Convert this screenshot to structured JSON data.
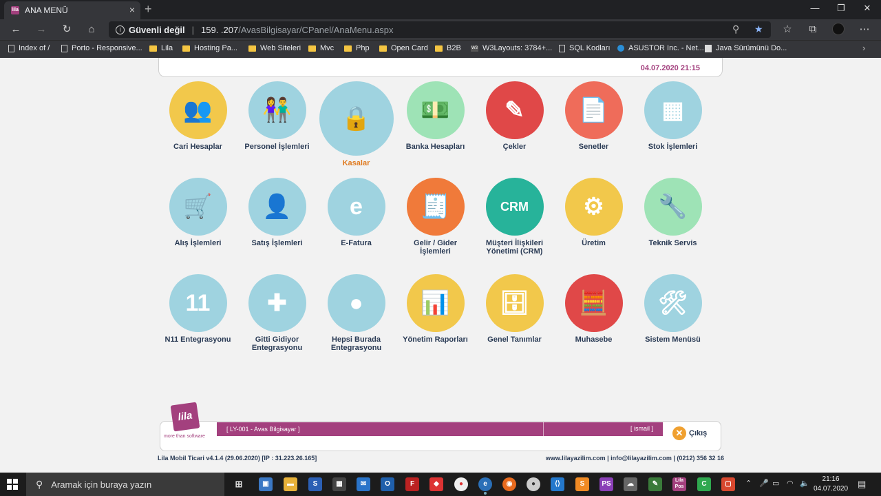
{
  "browser": {
    "tab_title": "ANA MENÜ",
    "tab_favicon_text": "lila",
    "security_label": "Güvenli değil",
    "url_host": "159.     .207",
    "url_path": "/AvasBilgisayar/CPanel/AnaMenu.aspx"
  },
  "bookmarks": [
    {
      "label": "Index of /",
      "icon": "page-icon"
    },
    {
      "label": "Porto - Responsive...",
      "icon": "page-icon"
    },
    {
      "label": "Lila",
      "icon": "folder-icon"
    },
    {
      "label": "Hosting Pa...",
      "icon": "folder-icon"
    },
    {
      "label": "Web Siteleri",
      "icon": "folder-icon"
    },
    {
      "label": "Mvc",
      "icon": "folder-icon"
    },
    {
      "label": "Php",
      "icon": "folder-icon"
    },
    {
      "label": "Open Card",
      "icon": "folder-icon"
    },
    {
      "label": "B2B",
      "icon": "folder-icon"
    },
    {
      "label": "W3Layouts: 3784+...",
      "icon": "w3-icon"
    },
    {
      "label": "SQL Kodları",
      "icon": "page-icon"
    },
    {
      "label": "ASUSTOR Inc. - Net...",
      "icon": "asus-icon"
    },
    {
      "label": "Java Sürümünü Do...",
      "icon": "java-icon"
    }
  ],
  "header": {
    "datetime": "04.07.2020 21:15"
  },
  "menu": [
    {
      "label": "Cari Hesaplar",
      "icon": "people-icon",
      "color": "#f2c84b",
      "glyph": "👥"
    },
    {
      "label": "Personel İşlemleri",
      "icon": "staff-icon",
      "color": "#9fd3e0",
      "glyph": "👫"
    },
    {
      "label": "Kasalar",
      "icon": "safe-icon",
      "color": "#9fd3e0",
      "glyph": "🔒"
    },
    {
      "label": "Banka Hesapları",
      "icon": "money-icon",
      "color": "#9ee3b6",
      "glyph": "💵"
    },
    {
      "label": "Çekler",
      "icon": "cheque-icon",
      "color": "#e04848",
      "glyph": "✎"
    },
    {
      "label": "Senetler",
      "icon": "note-icon",
      "color": "#ef6c5a",
      "glyph": "📄"
    },
    {
      "label": "Stok İşlemleri",
      "icon": "boxes-icon",
      "color": "#9fd3e0",
      "glyph": "▦"
    },
    {
      "label": "Alış İşlemleri",
      "icon": "cart-icon",
      "color": "#9fd3e0",
      "glyph": "🛒"
    },
    {
      "label": "Satış İşlemleri",
      "icon": "sales-icon",
      "color": "#9fd3e0",
      "glyph": "👤"
    },
    {
      "label": "E-Fatura",
      "icon": "efatura-icon",
      "color": "#9fd3e0",
      "glyph": "e"
    },
    {
      "label": "Gelir / Gider İşlemleri",
      "icon": "invoice-icon",
      "color": "#f07a3a",
      "glyph": "🧾"
    },
    {
      "label": "Müşteri İlişkileri Yönetimi (CRM)",
      "icon": "crm-icon",
      "color": "#27b39a",
      "glyph": "CRM"
    },
    {
      "label": "Üretim",
      "icon": "gears-icon",
      "color": "#f2c84b",
      "glyph": "⚙"
    },
    {
      "label": "Teknik Servis",
      "icon": "technician-icon",
      "color": "#9ee3b6",
      "glyph": "🔧"
    },
    {
      "label": "N11 Entegrasyonu",
      "icon": "n11-icon",
      "color": "#9fd3e0",
      "glyph": "11"
    },
    {
      "label": "Gitti Gidiyor Entegrasyonu",
      "icon": "pinwheel-icon",
      "color": "#9fd3e0",
      "glyph": "✚"
    },
    {
      "label": "Hepsi Burada Entegrasyonu",
      "icon": "hepsiburada-icon",
      "color": "#9fd3e0",
      "glyph": "●"
    },
    {
      "label": "Yönetim Raporları",
      "icon": "report-icon",
      "color": "#f2c84b",
      "glyph": "📊"
    },
    {
      "label": "Genel Tanımlar",
      "icon": "database-icon",
      "color": "#f2c84b",
      "glyph": "🗄"
    },
    {
      "label": "Muhasebe",
      "icon": "register-icon",
      "color": "#e04848",
      "glyph": "🧮"
    },
    {
      "label": "Sistem Menüsü",
      "icon": "tools-icon",
      "color": "#9fd3e0",
      "glyph": "🛠"
    }
  ],
  "footer": {
    "logo_text": "lila",
    "logo_tagline": "more than software",
    "company": "[ LY-001 - Avas Bilgisayar ]",
    "user": "[ ismail ]",
    "logout_label": "Çıkış",
    "version": "Lila Mobil Ticari v4.1.4 (29.06.2020) [IP : 31.223.26.165]",
    "contact": "www.lilayazilim.com | info@lilayazilim.com | (0212) 356 32 16"
  },
  "taskbar": {
    "search_placeholder": "Aramak için buraya yazın",
    "time": "21:16",
    "date": "04.07.2020"
  }
}
